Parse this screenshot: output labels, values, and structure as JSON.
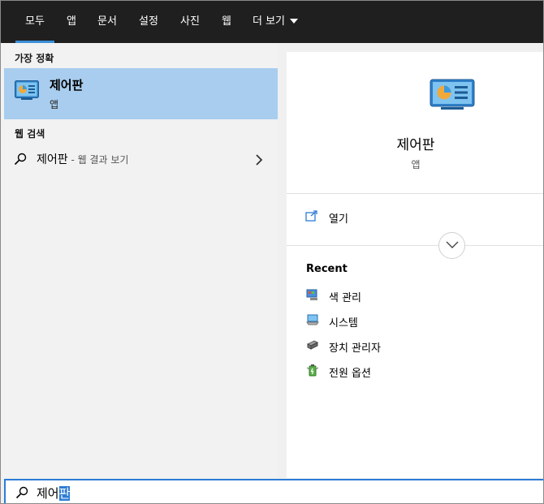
{
  "tabs": [
    {
      "label": "모두"
    },
    {
      "label": "앱"
    },
    {
      "label": "문서"
    },
    {
      "label": "설정"
    },
    {
      "label": "사진"
    },
    {
      "label": "웹"
    },
    {
      "label": "더 보기"
    }
  ],
  "best_match": {
    "section_title": "가장 정확",
    "name": "제어판",
    "type": "앱",
    "icon": "control-panel-icon"
  },
  "web_search": {
    "section_title": "웹 검색",
    "query": "제어판",
    "suffix": " - 웹 결과 보기"
  },
  "detail": {
    "app_name": "제어판",
    "app_type": "앱",
    "open_label": "열기",
    "recent_title": "Recent",
    "recent_items": [
      {
        "label": "색 관리",
        "icon": "color-management-icon"
      },
      {
        "label": "시스템",
        "icon": "system-icon"
      },
      {
        "label": "장치 관리자",
        "icon": "device-manager-icon"
      },
      {
        "label": "전원 옵션",
        "icon": "power-options-icon"
      }
    ]
  },
  "search": {
    "typed": "제어",
    "selected": "판"
  },
  "colors": {
    "nav_bg": "#1f1f1f",
    "accent": "#2d7cd6",
    "selected_bg": "#a8cdee"
  }
}
